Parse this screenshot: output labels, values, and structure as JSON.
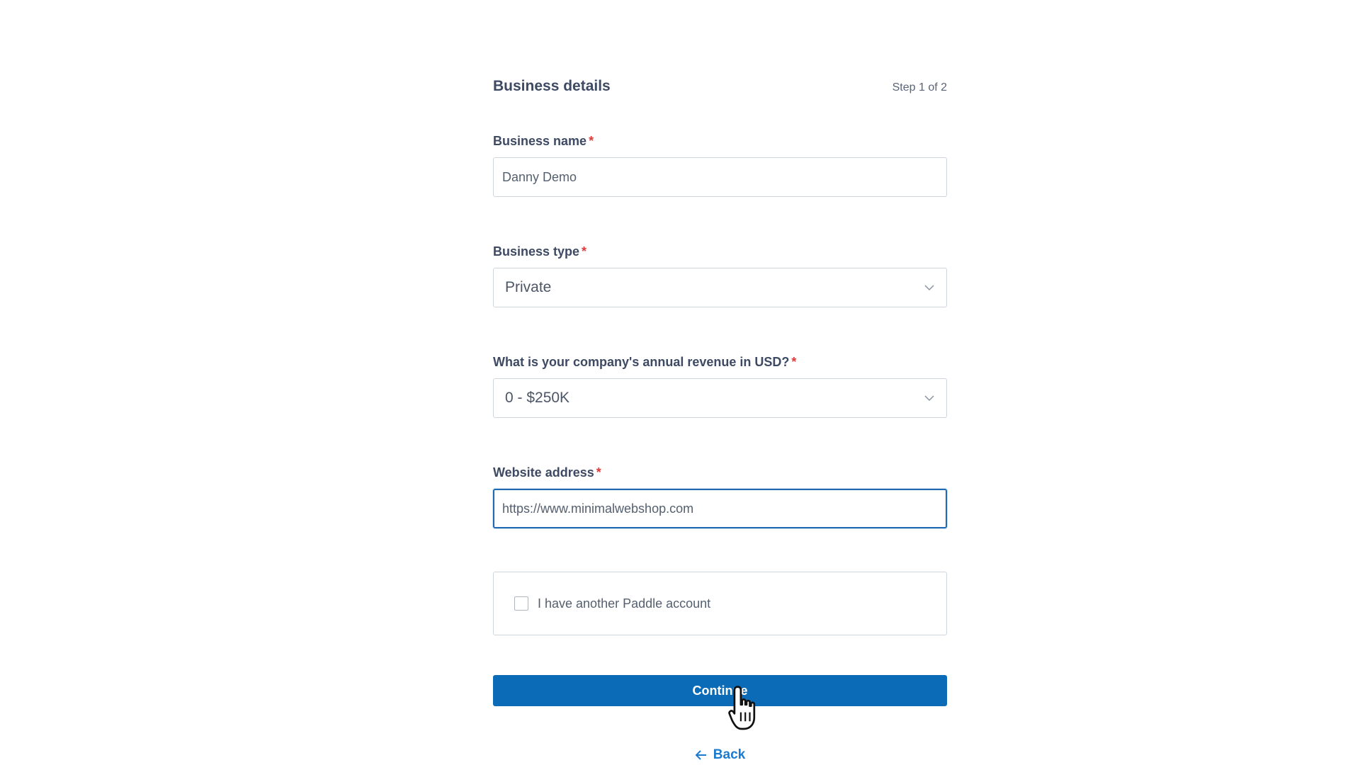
{
  "form": {
    "title": "Business details",
    "step": "Step 1 of 2",
    "required_marker": "*"
  },
  "fields": {
    "business_name": {
      "label": "Business name",
      "value": "Danny Demo"
    },
    "business_type": {
      "label": "Business type",
      "value": "Private"
    },
    "revenue": {
      "label": "What is your company's annual revenue in USD?",
      "value": "0 - $250K"
    },
    "website": {
      "label": "Website address",
      "value": "https://www.minimalwebshop.com"
    }
  },
  "checkbox": {
    "label": "I have another Paddle account",
    "checked": false
  },
  "buttons": {
    "continue": "Continue",
    "back": "Back"
  },
  "icons": {
    "select_arrow": "chevron-down-icon",
    "back_arrow": "arrow-left-icon",
    "cursor": "hand-pointer-icon"
  },
  "colors": {
    "primary": "#0b6bb6",
    "link": "#1a7ad0",
    "required": "#e03b3b",
    "focus_border": "#1f6ab3"
  }
}
